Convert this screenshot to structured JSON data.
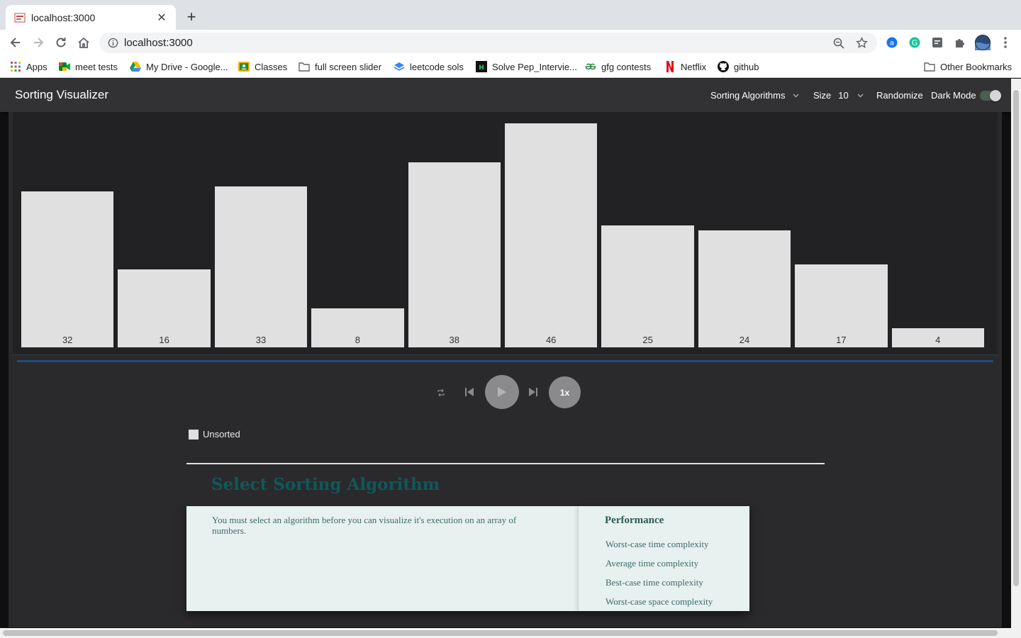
{
  "browser": {
    "tab_title": "localhost:3000",
    "url": "localhost:3000",
    "bookmarks": [
      "Apps",
      "meet tests",
      "My Drive - Google...",
      "Classes",
      "full screen slider",
      "leetcode sols",
      "Solve Pep_Intervie...",
      "gfg contests",
      "Netflix",
      "github"
    ],
    "other_bookmarks": "Other Bookmarks"
  },
  "app": {
    "brand": "Sorting Visualizer",
    "menu": {
      "algorithms": "Sorting Algorithms",
      "size_label": "Size",
      "size_value": "10",
      "randomize": "Randomize",
      "dark_mode": "Dark Mode",
      "dark_mode_on": true
    },
    "array": [
      32,
      16,
      33,
      8,
      38,
      46,
      25,
      24,
      17,
      4
    ],
    "bar_color": "#e0e0e0",
    "speed": "1x",
    "legend": {
      "unsorted": "Unsorted"
    },
    "section_title": "Select Sorting Algorithm",
    "description": "You must select an algorithm before you can visualize it's execution on an array of numbers.",
    "performance": {
      "title": "Performance",
      "items": [
        "Worst-case time complexity",
        "Average time complexity",
        "Best-case time complexity",
        "Worst-case space complexity"
      ]
    }
  }
}
